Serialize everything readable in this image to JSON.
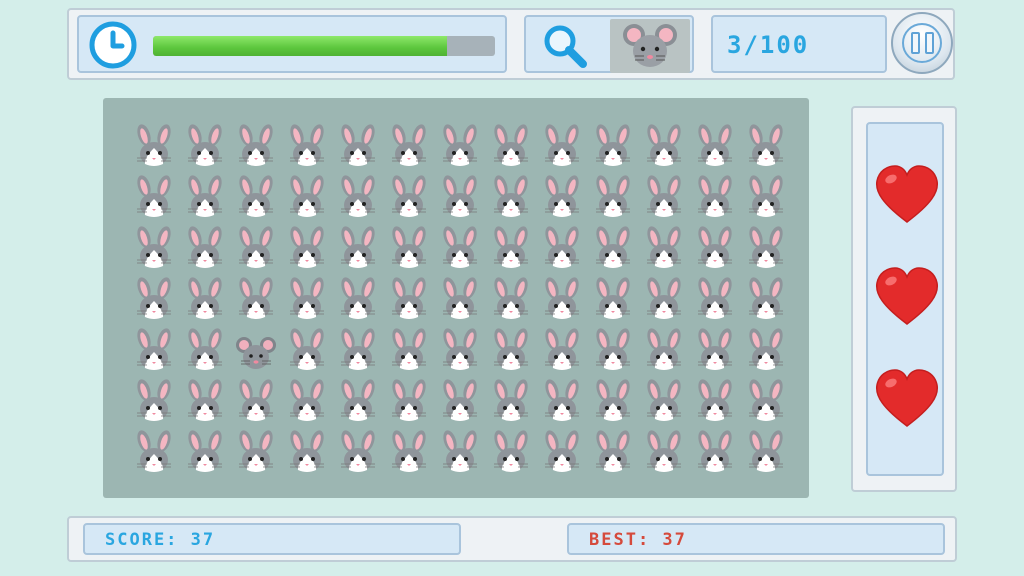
{
  "hud": {
    "timer": {
      "icon": "clock-icon",
      "progress": 0.86
    },
    "target": {
      "search_icon": "magnifier-icon",
      "animal": "mouse"
    },
    "found_count": "3/100",
    "pause": {
      "icon": "pause-icon"
    }
  },
  "board": {
    "rows": 7,
    "columns": 13,
    "filler_animal": "bunny",
    "odd_animal": "mouse",
    "odd_cell": {
      "row": 5,
      "column": 3
    }
  },
  "lives": {
    "count": 3,
    "icon": "heart-icon"
  },
  "footer": {
    "score_label": "SCORE: 37",
    "best_label": "BEST: 37"
  },
  "colors": {
    "background": "#d4eeea",
    "board": "#9cb6b2",
    "accent_blue": "#2aa6e0",
    "best_red": "#d54a3c",
    "progress_green": "#5cc63d",
    "heart_red": "#e32b2b"
  }
}
